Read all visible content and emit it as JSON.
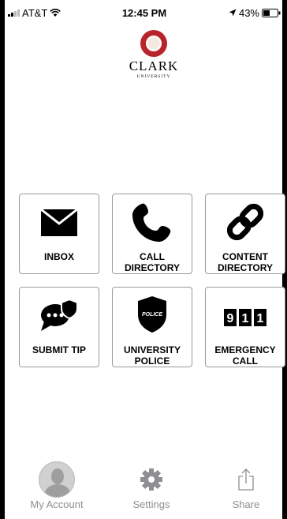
{
  "status_bar": {
    "carrier": "AT&T",
    "time": "12:45 PM",
    "battery": "43%"
  },
  "logo": {
    "name": "CLARK",
    "sub": "UNIVERSITY"
  },
  "tiles": [
    {
      "label_1": "INBOX",
      "label_2": "",
      "icon": "envelope-icon"
    },
    {
      "label_1": "CALL",
      "label_2": "DIRECTORY",
      "icon": "phone-icon"
    },
    {
      "label_1": "CONTENT",
      "label_2": "DIRECTORY",
      "icon": "link-icon"
    },
    {
      "label_1": "SUBMIT TIP",
      "label_2": "",
      "icon": "chat-shield-icon"
    },
    {
      "label_1": "UNIVERSITY",
      "label_2": "POLICE",
      "icon": "police-badge-icon"
    },
    {
      "label_1": "EMERGENCY",
      "label_2": "CALL",
      "icon": "emergency-911-icon"
    }
  ],
  "icon_text": {
    "police": "POLICE",
    "d1": "9",
    "d2": "1",
    "d3": "1"
  },
  "tab_bar": [
    {
      "label": "My Account",
      "icon": "avatar-icon"
    },
    {
      "label": "Settings",
      "icon": "gear-icon"
    },
    {
      "label": "Share",
      "icon": "share-icon"
    }
  ],
  "colors": {
    "brand": "#b8242c",
    "tab_inactive": "#8e8e93",
    "tile_border": "#9a9a9a"
  }
}
